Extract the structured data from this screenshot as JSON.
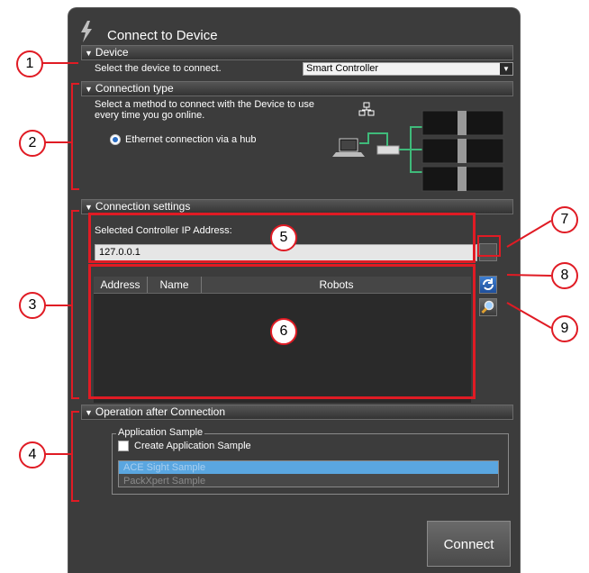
{
  "window": {
    "title": "Connect to Device"
  },
  "device_section": {
    "header": "Device",
    "prompt": "Select the device to connect.",
    "selected_device": "Smart Controller"
  },
  "connection_type_section": {
    "header": "Connection type",
    "description_line1": "Select a method to connect with the Device to use",
    "description_line2": "every time you go online.",
    "option_label": "Ethernet connection via a hub"
  },
  "connection_settings_section": {
    "header": "Connection settings",
    "ip_label": "Selected Controller IP Address:",
    "ip_value": "127.0.0.1",
    "table_columns": [
      "Address",
      "Name",
      "Robots"
    ]
  },
  "operation_section": {
    "header": "Operation after Connection",
    "group_label": "Application Sample",
    "checkbox_label": "Create Application Sample",
    "samples": [
      "ACE Sight Sample",
      "PackXpert Sample"
    ]
  },
  "connect_button": "Connect",
  "callouts": [
    "1",
    "2",
    "3",
    "4",
    "5",
    "6",
    "7",
    "8",
    "9"
  ],
  "colors": {
    "accent": "#e01b24",
    "selection": "#5aa6e0",
    "panel": "#3c3c3c"
  }
}
